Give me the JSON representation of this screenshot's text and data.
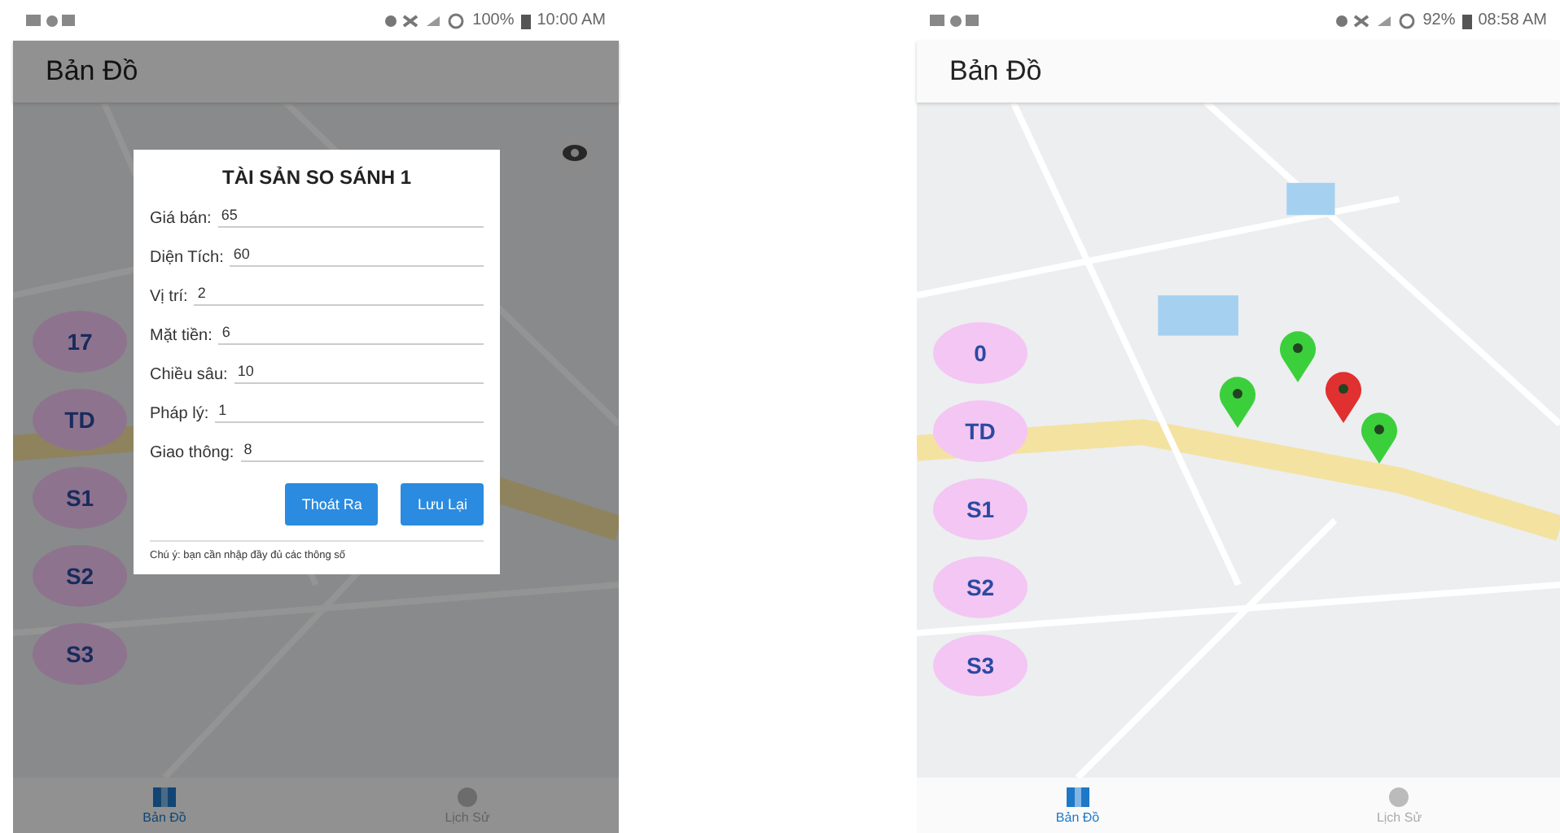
{
  "screens": [
    {
      "status": {
        "battery": "100%",
        "time": "10:00 AM"
      },
      "title": "Bản Đồ",
      "map_controls": [
        {
          "kind": "eye"
        }
      ],
      "map_buttons": [
        "17",
        "TD",
        "S1",
        "S2",
        "S3"
      ],
      "dialog": {
        "title": "TÀI SẢN SO SÁNH 1",
        "fields": [
          {
            "label": "Giá bán:",
            "value": "65"
          },
          {
            "label": "Diện Tích:",
            "value": "60"
          },
          {
            "label": "Vị trí:",
            "value": "2"
          },
          {
            "label": "Mặt tiền:",
            "value": "6"
          },
          {
            "label": "Chiều sâu:",
            "value": "10"
          },
          {
            "label": "Pháp lý:",
            "value": "1"
          },
          {
            "label": "Giao thông:",
            "value": "8"
          }
        ],
        "buttons": [
          "Thoát Ra",
          "Lưu Lại"
        ],
        "note": "Chú ý: bạn cần nhập đầy đủ các thông số"
      },
      "tabs": [
        {
          "label": "Bản Đồ",
          "selected": true
        },
        {
          "label": "Lịch Sử",
          "selected": false
        }
      ]
    },
    {
      "status": {
        "battery": "92%",
        "time": "08:58 AM"
      },
      "title": "Bản Đồ",
      "map_buttons": [
        "0",
        "TD",
        "S1",
        "S2",
        "S3"
      ],
      "pins": [
        {
          "color": "#3ccf3c"
        },
        {
          "color": "#3ccf3c"
        },
        {
          "color": "#e03030"
        },
        {
          "color": "#3ccf3c"
        }
      ],
      "tabs": [
        {
          "label": "Bản Đồ",
          "selected": true
        },
        {
          "label": "Lịch Sử",
          "selected": false
        }
      ]
    }
  ]
}
